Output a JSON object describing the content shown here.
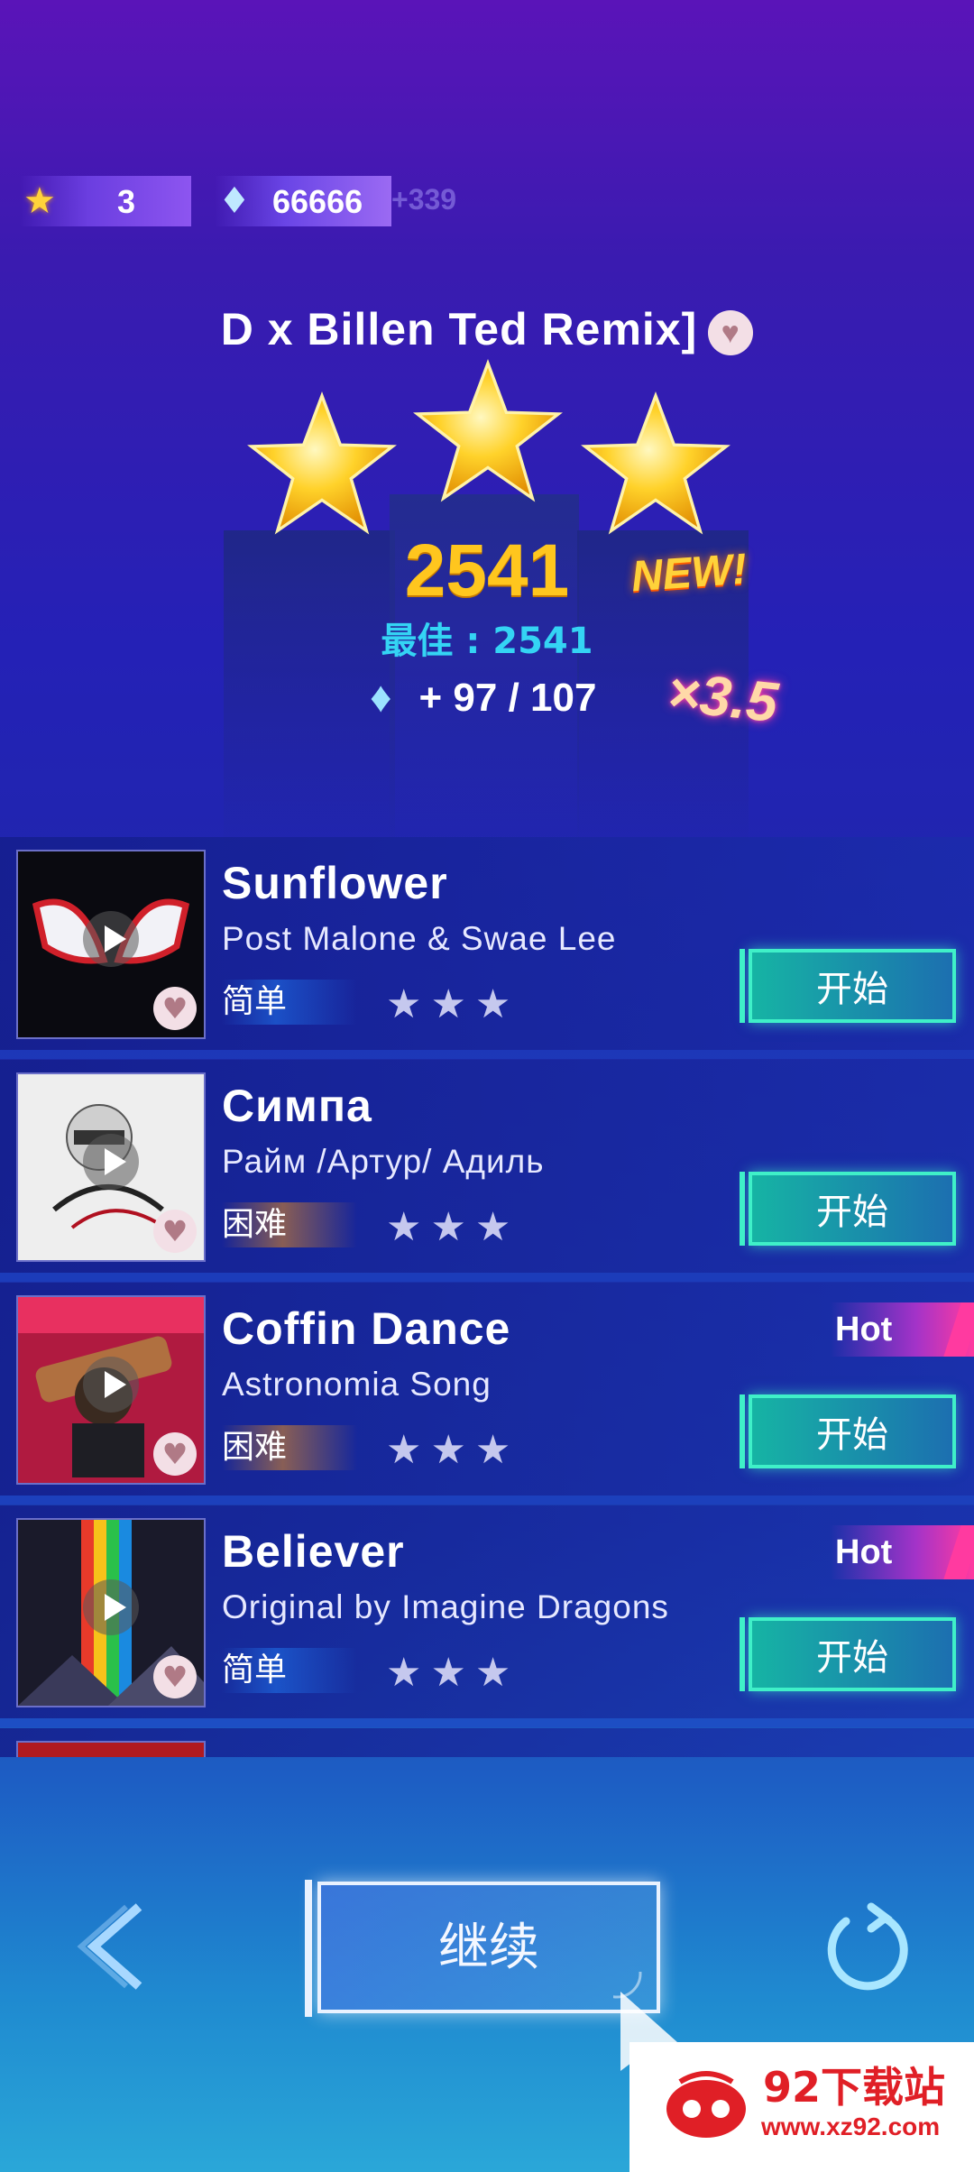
{
  "top_bar": {
    "stars_count": "3",
    "gems_count": "66666",
    "gems_bonus": "+339"
  },
  "result": {
    "song_title": "D x Billen Ted Remix]",
    "score": "2541",
    "new_label": "NEW!",
    "best_label": "最佳 : 2541",
    "reward": "+ 97 / 107",
    "multiplier": "×3.5",
    "stars_earned": 3
  },
  "songs": [
    {
      "name": "Sunflower",
      "artist": "Post Malone & Swae Lee",
      "difficulty": "简单",
      "stars": "★★★",
      "button": "开始",
      "hot": ""
    },
    {
      "name": "Симпа",
      "artist": "Райм /Артур/ Адиль",
      "difficulty": "困难",
      "stars": "★★★",
      "button": "开始",
      "hot": ""
    },
    {
      "name": "Coffin Dance",
      "artist": "Astronomia Song",
      "difficulty": "困难",
      "stars": "★★★",
      "button": "开始",
      "hot": "Hot"
    },
    {
      "name": "Believer",
      "artist": "Original by Imagine Dragons",
      "difficulty": "简单",
      "stars": "★★★",
      "button": "开始",
      "hot": "Hot"
    }
  ],
  "controls": {
    "continue_label": "继续"
  },
  "watermark": {
    "name": "92下载站",
    "url": "www.xz92.com"
  },
  "icons": {
    "star": "star-icon",
    "gem": "gem-icon",
    "heart": "heart-icon",
    "play": "play-icon",
    "back": "chevron-left-icon",
    "replay": "replay-icon"
  }
}
